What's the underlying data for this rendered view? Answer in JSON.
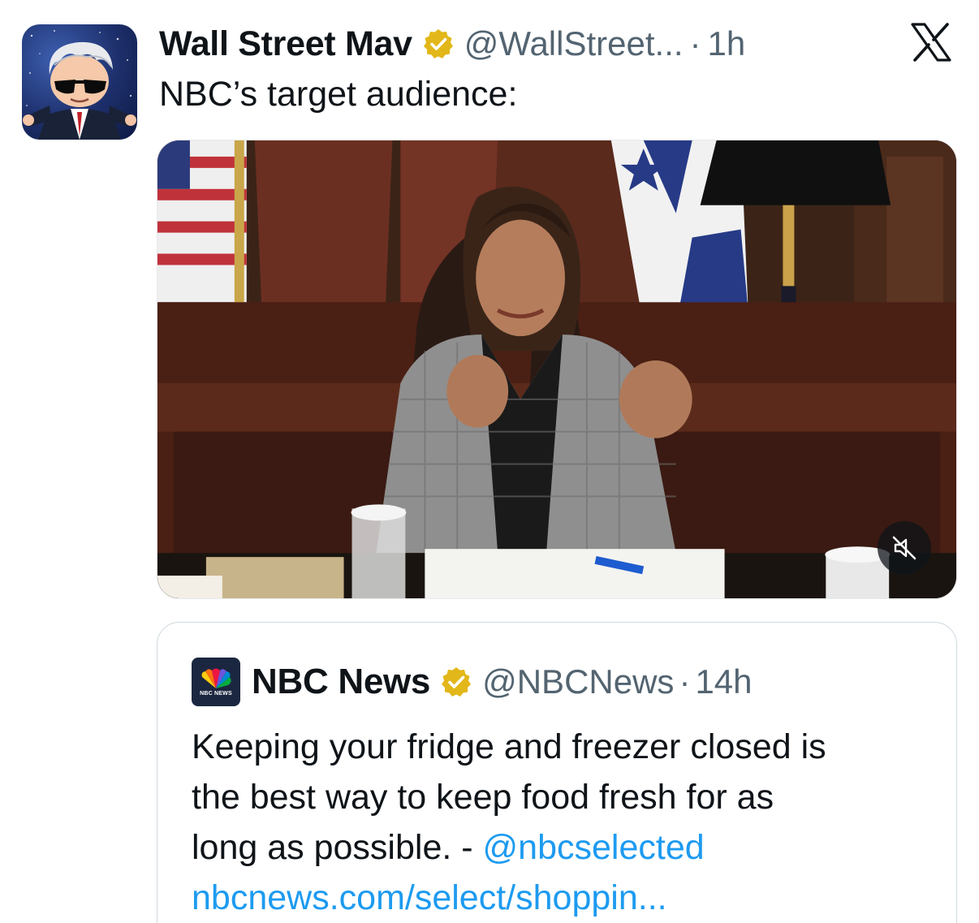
{
  "tweet": {
    "author_name": "Wall Street Mav",
    "handle": "@WallStreet...",
    "separator": "·",
    "time": "1h",
    "text": "NBC’s target audience:"
  },
  "quoted_tweet": {
    "author_name": "NBC News",
    "handle": "@NBCNews",
    "separator": "·",
    "time": "14h",
    "avatar_caption": "NBC NEWS",
    "text_lines": [
      "Keeping your fridge and freezer closed is",
      "the best way to keep food fresh for as",
      "long as possible. - "
    ],
    "mention": "@nbcselected",
    "link": "nbcnews.com/select/shoppin..."
  },
  "icons": {
    "verified": "verified-badge-icon",
    "close": "x-logo-icon",
    "mute": "speaker-muted-icon"
  },
  "colors": {
    "text": "#0f1419",
    "secondary": "#536471",
    "link": "#1d9bf0",
    "verified_gold": "#e2b719",
    "border": "#cfd9de"
  }
}
